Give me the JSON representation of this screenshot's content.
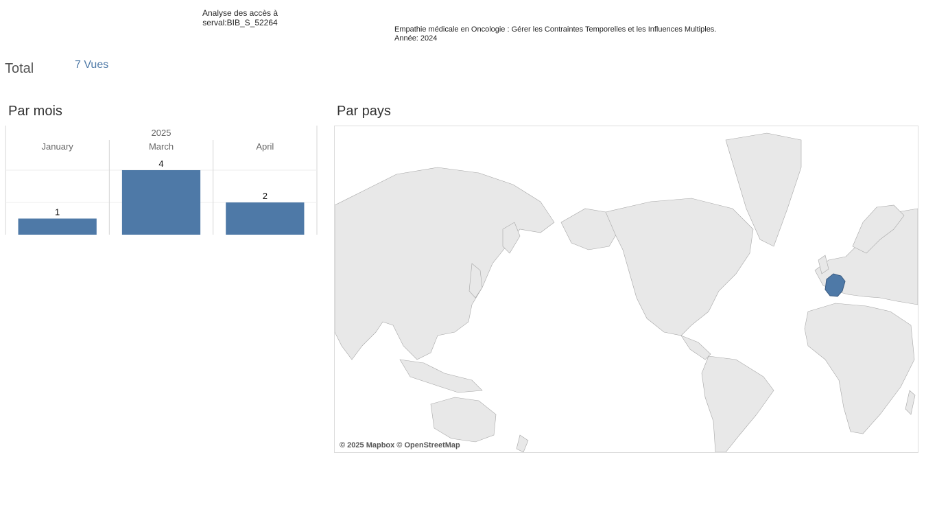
{
  "header": {
    "title_line1": "Analyse des accès à",
    "title_line2": "serval:BIB_S_52264",
    "doc_title": "Empathie médicale en Oncologie : Gérer les Contraintes Temporelles et les Influences Multiples.",
    "doc_year": "Année: 2024"
  },
  "total": {
    "label": "Total",
    "value": "7 Vues"
  },
  "sections": {
    "by_month": "Par mois",
    "by_country": "Par pays"
  },
  "chart_data": {
    "type": "bar",
    "group_label": "2025",
    "categories": [
      "January",
      "March",
      "April"
    ],
    "values": [
      1,
      4,
      2
    ],
    "ylim": [
      0,
      4
    ],
    "grid": true,
    "bar_color": "#4e79a7"
  },
  "map": {
    "attribution": "© 2025 Mapbox © OpenStreetMap",
    "highlighted_country": "France",
    "highlight_color": "#4e79a7",
    "land_color": "#e8e8e8",
    "border_color": "#9a9a9a"
  }
}
